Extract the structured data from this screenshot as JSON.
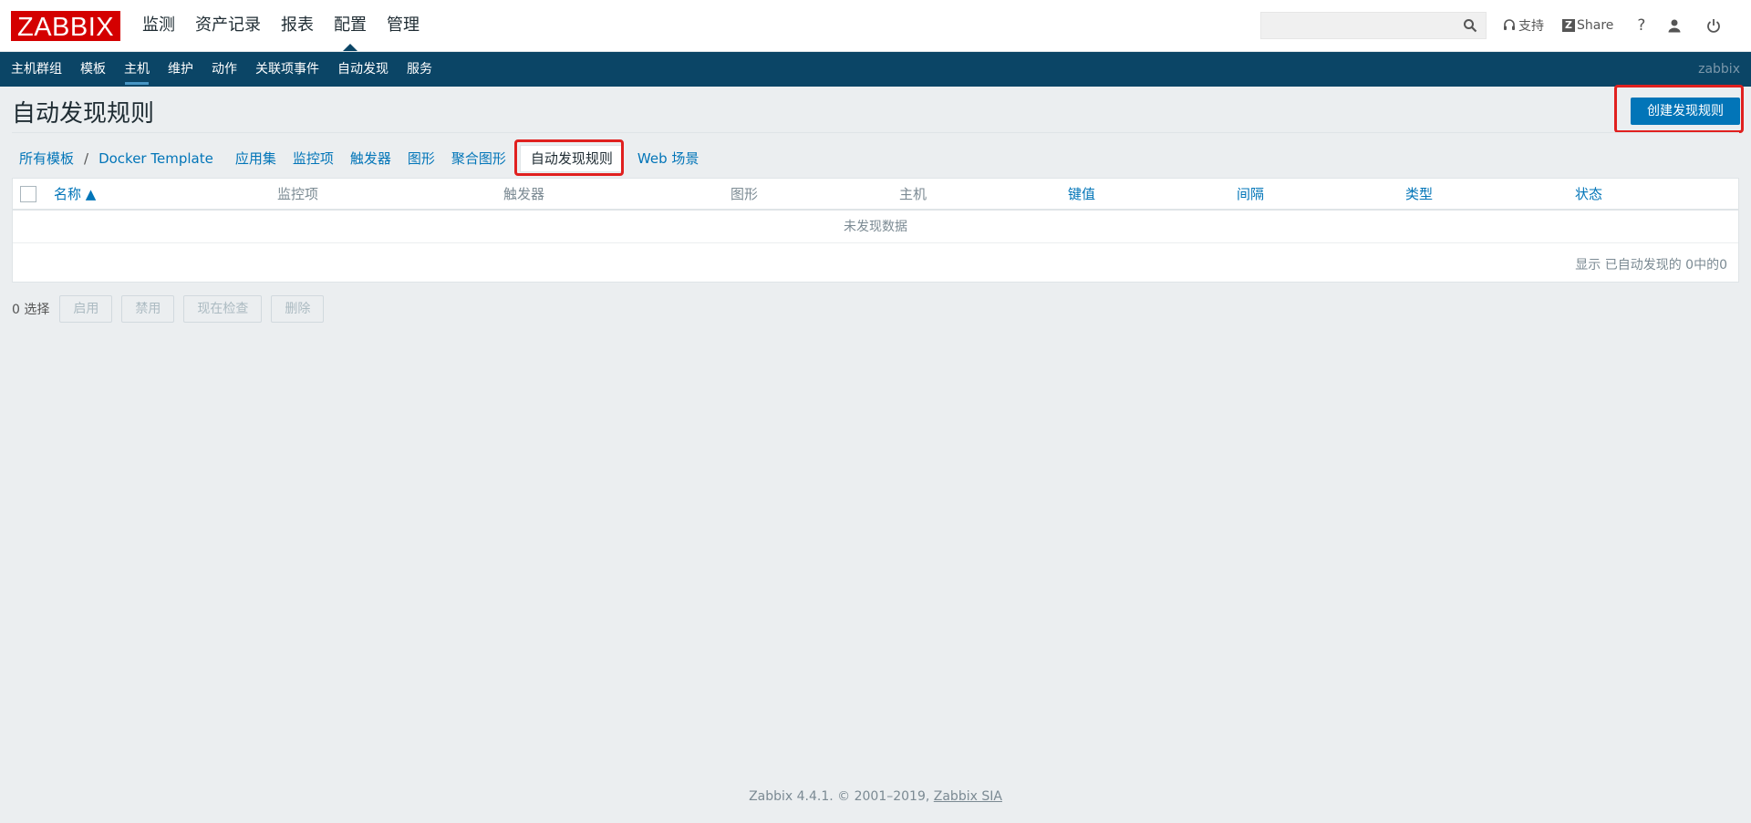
{
  "logo": "ZABBIX",
  "main_nav": [
    {
      "label": "监测",
      "active": false
    },
    {
      "label": "资产记录",
      "active": false
    },
    {
      "label": "报表",
      "active": false
    },
    {
      "label": "配置",
      "active": true
    },
    {
      "label": "管理",
      "active": false
    }
  ],
  "search": {
    "value": "",
    "placeholder": ""
  },
  "top_icons": {
    "support": "支持",
    "share": "Share",
    "help": "?"
  },
  "sub_nav": [
    {
      "label": "主机群组",
      "active": false
    },
    {
      "label": "模板",
      "active": false
    },
    {
      "label": "主机",
      "active": true
    },
    {
      "label": "维护",
      "active": false
    },
    {
      "label": "动作",
      "active": false
    },
    {
      "label": "关联项事件",
      "active": false
    },
    {
      "label": "自动发现",
      "active": false
    },
    {
      "label": "服务",
      "active": false
    }
  ],
  "user": "zabbix",
  "page_title": "自动发现规则",
  "create_button": "创建发现规则",
  "breadcrumb": {
    "all_templates": "所有模板",
    "separator": "/",
    "template": "Docker Template",
    "tabs": [
      "应用集",
      "监控项",
      "触发器",
      "图形",
      "聚合图形",
      "自动发现规则",
      "Web 场景"
    ],
    "current": "自动发现规则"
  },
  "table": {
    "headers": {
      "name": "名称 ▲",
      "items": "监控项",
      "triggers": "触发器",
      "graphs": "图形",
      "hosts": "主机",
      "key": "键值",
      "interval": "间隔",
      "type": "类型",
      "status": "状态"
    },
    "empty_text": "未发现数据",
    "pager": "显示 已自动发现的 0中的0"
  },
  "actions": {
    "selected": "0 选择",
    "enable": "启用",
    "disable": "禁用",
    "check_now": "现在检查",
    "delete": "删除"
  },
  "footer": {
    "text": "Zabbix 4.4.1. © 2001–2019,",
    "link": "Zabbix SIA"
  },
  "colors": {
    "brand_red": "#d40000",
    "nav_blue": "#0b4566",
    "link_blue": "#0275b8",
    "highlight_red": "#e0201f"
  }
}
